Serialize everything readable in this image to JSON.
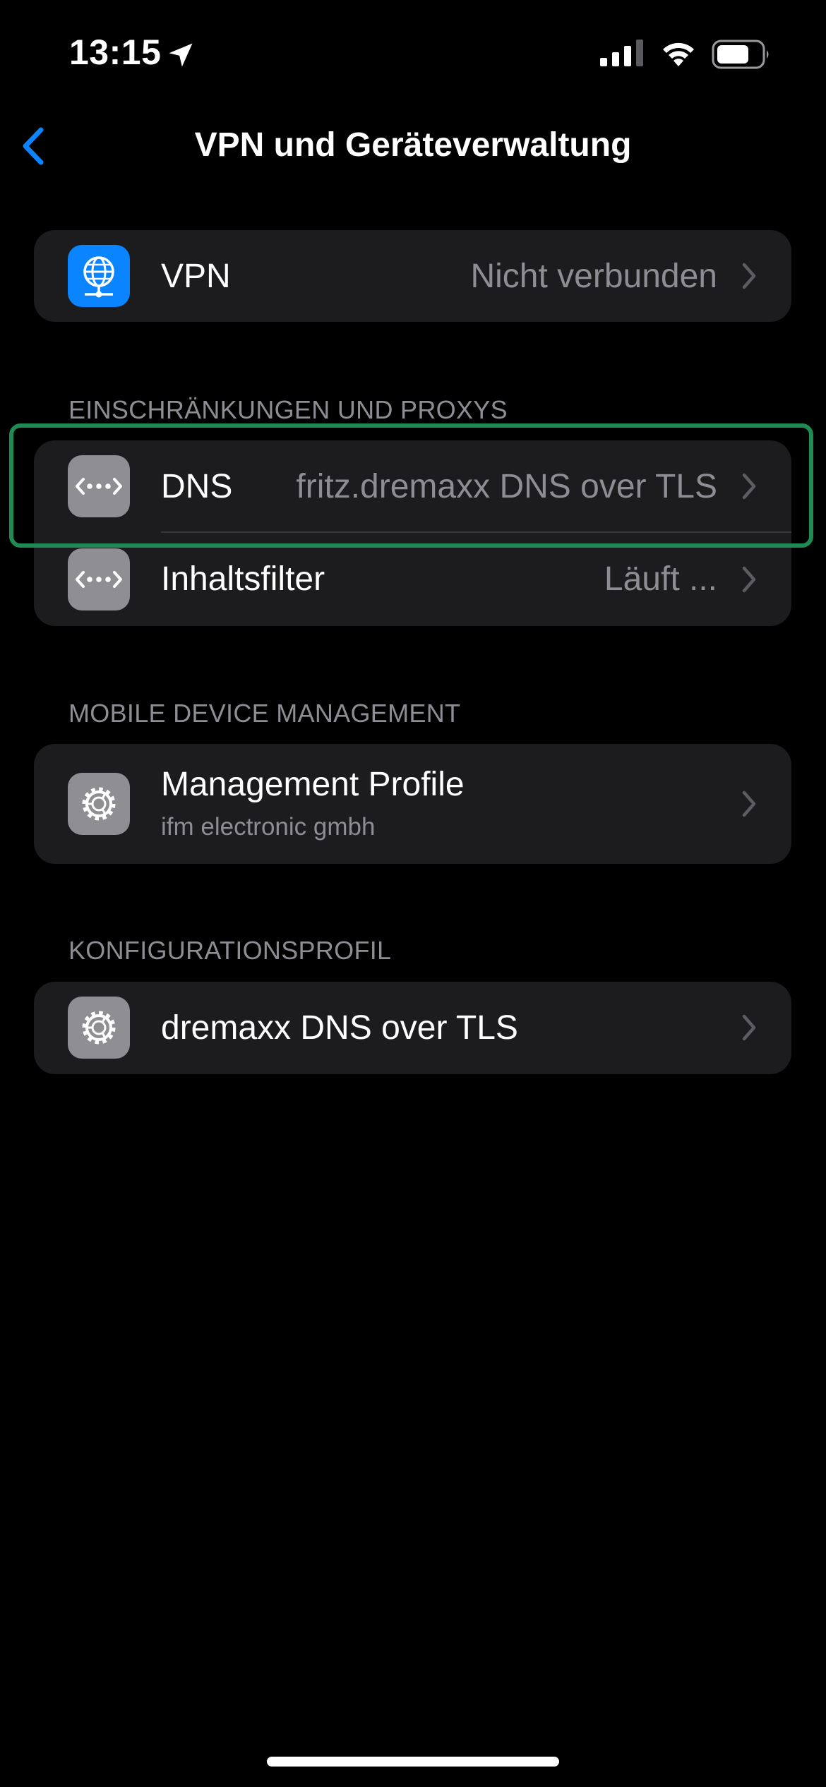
{
  "status_bar": {
    "time": "13:15",
    "icons": [
      "location-arrow-icon",
      "cellular-signal-icon",
      "wifi-icon",
      "battery-icon"
    ]
  },
  "nav": {
    "title": "VPN und Geräteverwaltung",
    "back_icon": "chevron-left-icon"
  },
  "colors": {
    "background": "#000000",
    "group_background": "#1c1c1e",
    "accent_blue": "#0a84ff",
    "secondary_text": "#8d8d93",
    "icon_gray": "#8e8e93",
    "highlight_green": "#1f8a53"
  },
  "vpn": {
    "label": "VPN",
    "value": "Nicht verbunden",
    "icon": "globe-network-icon"
  },
  "restrictions": {
    "header": "EINSCHRÄNKUNGEN UND PROXYS",
    "items": [
      {
        "label": "DNS",
        "value": "fritz.dremaxx DNS over TLS",
        "icon": "dots-arrows-icon"
      },
      {
        "label": "Inhaltsfilter",
        "value": "Läuft ...",
        "icon": "dots-arrows-icon"
      }
    ]
  },
  "mdm": {
    "header": "MOBILE DEVICE MANAGEMENT",
    "items": [
      {
        "label": "Management Profile",
        "subtitle": "ifm electronic gmbh",
        "icon": "gear-icon"
      }
    ]
  },
  "config": {
    "header": "KONFIGURATIONSPROFIL",
    "items": [
      {
        "label": "dremaxx DNS over TLS",
        "icon": "gear-icon"
      }
    ]
  }
}
